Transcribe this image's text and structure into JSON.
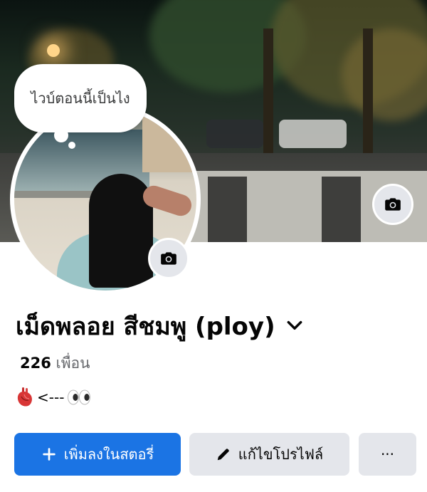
{
  "note": {
    "text": "ไวบ์ตอนนี้เป็นไง"
  },
  "profile": {
    "name": "เม็ดพลอย สีชมพู (ploy)",
    "friends_count": "226",
    "friends_label": "เพื่อน",
    "bio_text": "<---"
  },
  "actions": {
    "add_story_label": "เพิ่มลงในสตอรี่",
    "edit_profile_label": "แก้ไขโปรไฟล์",
    "more_label": "···"
  },
  "colors": {
    "primary": "#1b74e4",
    "secondary_button": "#e4e6eb",
    "text": "#050505",
    "muted_text": "#65676b"
  },
  "icons": [
    "camera-icon",
    "chevron-down-icon",
    "anatomical-heart-emoji",
    "eyes-emoji",
    "plus-icon",
    "pencil-icon",
    "more-icon"
  ]
}
